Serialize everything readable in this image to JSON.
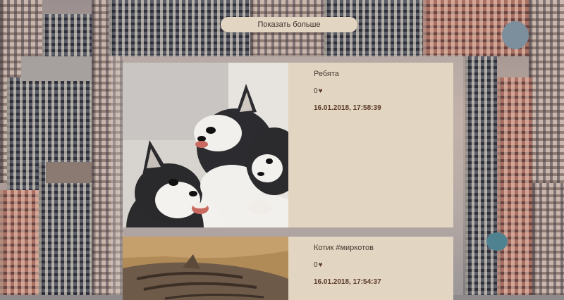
{
  "show_more_label": "Показать больше",
  "posts": [
    {
      "title": "Ребята",
      "likes": "0",
      "date": "16.01.2018, 17:58:39",
      "image_subject": "husky puppies"
    },
    {
      "title": "Котик #миркотов",
      "likes": "0",
      "date": "16.01.2018, 17:54:37",
      "image_subject": "tabby cat"
    }
  ],
  "colors": {
    "card_bg": "#e2d5c1",
    "button_bg": "#e2d5c2",
    "date_text": "#5a3a28"
  },
  "icons": {
    "like": "heart-icon"
  }
}
